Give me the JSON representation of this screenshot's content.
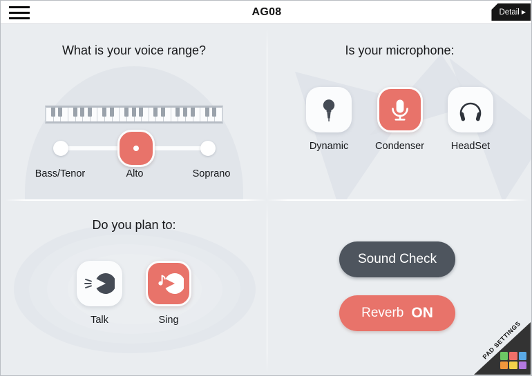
{
  "header": {
    "title": "AG08",
    "menu_icon": "hamburger-menu-icon",
    "detail_label": "Detail",
    "detail_arrow": "▶"
  },
  "voice_range": {
    "title": "What is your voice range?",
    "labels": [
      "Bass/Tenor",
      "Alto",
      "Soprano"
    ],
    "selected_index": 1,
    "selected_value": "Alto",
    "keyboard_icon": "piano-keyboard-icon"
  },
  "microphone": {
    "title": "Is your microphone:",
    "options": [
      {
        "label": "Dynamic",
        "icon": "dynamic-microphone-icon",
        "selected": false
      },
      {
        "label": "Condenser",
        "icon": "condenser-microphone-icon",
        "selected": true
      },
      {
        "label": "HeadSet",
        "icon": "headset-icon",
        "selected": false
      }
    ],
    "selected_value": "Condenser"
  },
  "plan": {
    "title": "Do you plan to:",
    "options": [
      {
        "label": "Talk",
        "icon": "talking-face-icon",
        "selected": false
      },
      {
        "label": "Sing",
        "icon": "singing-face-icon",
        "selected": true
      }
    ],
    "selected_value": "Sing"
  },
  "controls": {
    "sound_check_label": "Sound Check",
    "reverb_label": "Reverb",
    "reverb_state": "ON"
  },
  "pad_settings": {
    "label": "PAD SETTINGS",
    "pad_colors": [
      "#6cc664",
      "#ee6f68",
      "#5aa9e6",
      "#f0963c",
      "#f2d04a",
      "#b478e0"
    ]
  },
  "colors": {
    "accent": "#e8736a",
    "dark": "#4e555e",
    "background": "#eaedf0",
    "card": "#fbfcfd"
  }
}
